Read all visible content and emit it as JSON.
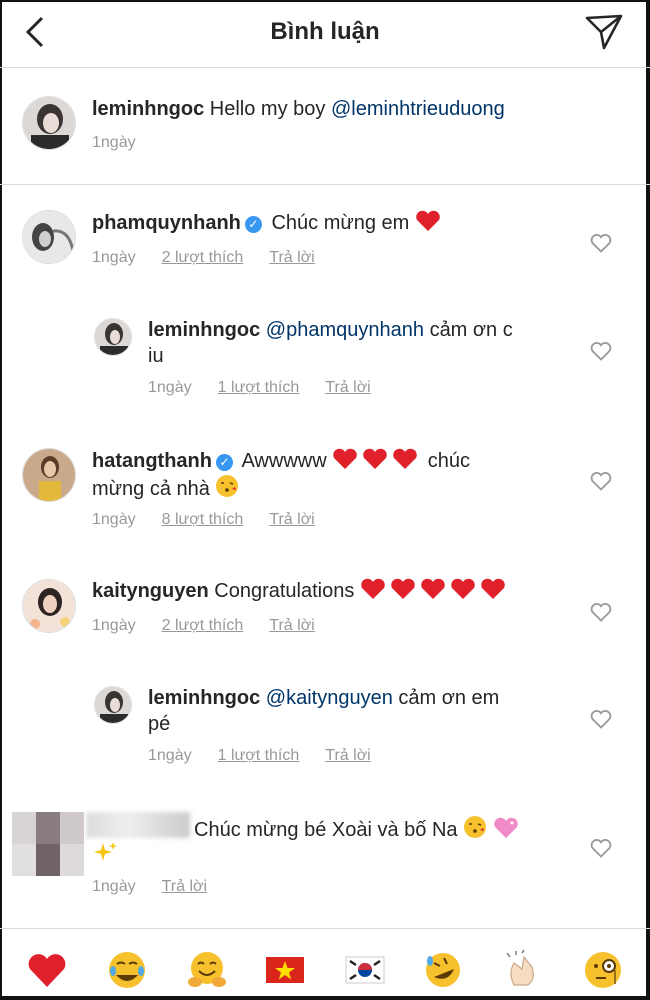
{
  "header": {
    "title": "Bình luận"
  },
  "caption": {
    "user": "leminhngoc",
    "text": "Hello my boy",
    "mention": "@leminhtrieuduong",
    "time": "1ngày"
  },
  "comments": [
    {
      "user": "phamquynhanh",
      "text": "Chúc mừng em",
      "time": "1ngày",
      "likes": "2 lượt thích",
      "reply": "Trả lời"
    },
    {
      "user": "leminhngoc",
      "mention": "@phamquynhanh",
      "text_line1": "cảm ơn c",
      "text_line2": "iu",
      "time": "1ngày",
      "likes": "1 lượt thích",
      "reply": "Trả lời"
    },
    {
      "user": "hatangthanh",
      "text_a": "Awwwww",
      "text_b": "chúc",
      "text_line2": "mừng cả nhà",
      "time": "1ngày",
      "likes": "8 lượt thích",
      "reply": "Trả lời"
    },
    {
      "user": "kaitynguyen",
      "text": "Congratulations",
      "time": "1ngày",
      "likes": "2 lượt thích",
      "reply": "Trả lời"
    },
    {
      "user": "leminhngoc",
      "mention": "@kaitynguyen",
      "text_line1": "cảm ơn em",
      "text_line2": "pé",
      "time": "1ngày",
      "likes": "1 lượt thích",
      "reply": "Trả lời"
    },
    {
      "user": "",
      "text": "Chúc mừng bé Xoài và bố Na",
      "time": "1ngày",
      "reply": "Trả lời"
    }
  ],
  "quick_reactions": [
    "❤️",
    "😂",
    "🤗",
    "🇻🇳",
    "🇰🇷",
    "🤣",
    "👏",
    "🧐"
  ],
  "colors": {
    "heart_red": "#e0202a",
    "mention": "#003569",
    "verified": "#3897f0",
    "meta_gray": "#999999"
  }
}
